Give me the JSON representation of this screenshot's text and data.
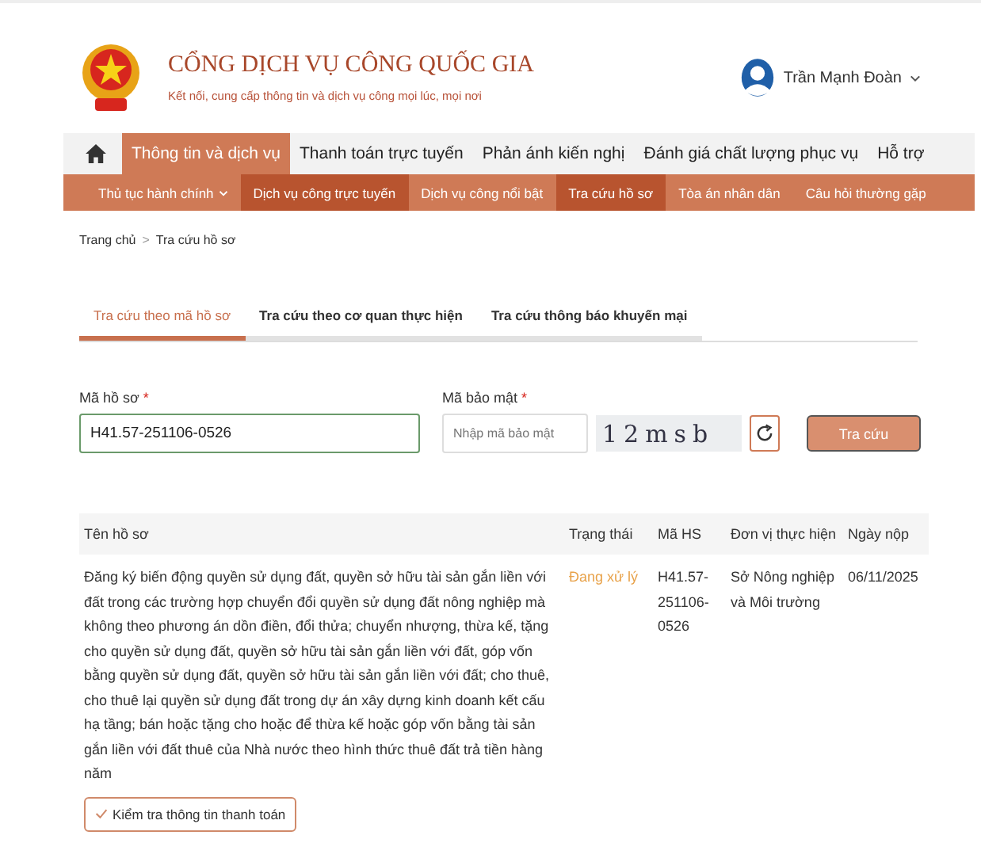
{
  "header": {
    "brand_title": "CỔNG DỊCH VỤ CÔNG QUỐC GIA",
    "brand_tagline": "Kết nối, cung cấp thông tin và dịch vụ công mọi lúc, mọi nơi",
    "user": {
      "name": "Trần Mạnh Đoàn",
      "has_dropdown": true
    }
  },
  "main_nav": [
    {
      "label": "Thông tin và dịch vụ",
      "selected": true
    },
    {
      "label": "Thanh toán trực tuyến",
      "selected": false
    },
    {
      "label": "Phản ánh kiến nghị",
      "selected": false
    },
    {
      "label": "Đánh giá chất lượng phục vụ",
      "selected": false
    },
    {
      "label": "Hỗ trợ",
      "selected": false
    }
  ],
  "sub_nav": [
    {
      "label": "Thủ tục hành chính",
      "selected": false,
      "has_dropdown": true
    },
    {
      "label": "Dịch vụ công trực tuyến",
      "selected": true,
      "has_dropdown": false
    },
    {
      "label": "Dịch vụ công nổi bật",
      "selected": false,
      "has_dropdown": false
    },
    {
      "label": "Tra cứu hồ sơ",
      "selected": true,
      "has_dropdown": false
    },
    {
      "label": "Tòa án nhân dân",
      "selected": false,
      "has_dropdown": false
    },
    {
      "label": "Câu hỏi thường gặp",
      "selected": false,
      "has_dropdown": false
    }
  ],
  "breadcrumb": [
    {
      "label": "Trang chủ"
    },
    {
      "label": "Tra cứu hồ sơ"
    }
  ],
  "breadcrumb_separator": ">",
  "tabs": [
    {
      "label": "Tra cứu theo mã hồ sơ",
      "selected": true
    },
    {
      "label": "Tra cứu theo cơ quan thực hiện",
      "selected": false
    },
    {
      "label": "Tra cứu thông báo khuyến mại",
      "selected": false
    }
  ],
  "form": {
    "record_code": {
      "label": "Mã hồ sơ",
      "required_mark": "*",
      "value": "H41.57-251106-0526"
    },
    "security_code": {
      "label": "Mã bảo mật",
      "required_mark": "*",
      "placeholder": "Nhập mã bảo mật"
    },
    "captcha": "12msb",
    "submit": "Tra cứu"
  },
  "table": {
    "columns": [
      "Tên hồ sơ",
      "Trạng thái",
      "Mã HS",
      "Đơn vị thực hiện",
      "Ngày nộp"
    ],
    "rows": [
      {
        "name": "Đăng ký biến động quyền sử dụng đất, quyền sở hữu tài sản gắn liền với đất trong các trường hợp chuyển đổi quyền sử dụng đất nông nghiệp mà không theo phương án dồn điền, đổi thửa; chuyển nhượng, thừa kế, tặng cho quyền sử dụng đất, quyền sở hữu tài sản gắn liền với đất, góp vốn bằng quyền sử dụng đất, quyền sở hữu tài sản gắn liền với đất; cho thuê, cho thuê lại quyền sử dụng đất trong dự án xây dựng kinh doanh kết cấu hạ tầng; bán hoặc tặng cho hoặc để thừa kế hoặc góp vốn bằng tài sản gắn liền với đất thuê của Nhà nước theo hình thức thuê đất trả tiền hàng năm",
        "status": "Đang xử lý",
        "code": "H41.57-251106-0526",
        "agency": "Sở Nông nghiệp và Môi trường",
        "date": "06/11/2025",
        "action": "Kiểm tra thông tin thanh toán"
      }
    ]
  }
}
